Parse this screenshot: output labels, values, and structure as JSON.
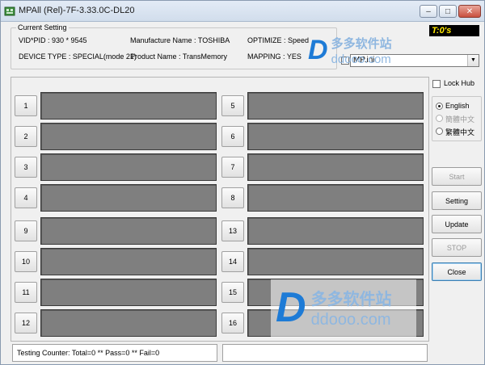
{
  "window": {
    "title": "MPAll (Rel)-7F-3.33.0C-DL20",
    "min_label": "–",
    "max_label": "□",
    "close_label": "✕"
  },
  "current_setting": {
    "title": "Current Setting",
    "vid_pid": "VID*PID :  930 * 9545",
    "manufacture": "Manufacture Name : TOSHIBA",
    "optimize": "OPTIMIZE : Speed",
    "device_type": "DEVICE TYPE : SPECIAL(mode 21)",
    "product": "Product Name : TransMemory",
    "mapping": "MAPPING : YES"
  },
  "timer": "T:0's",
  "ini": {
    "value": "MP.ini",
    "arrow": "▼"
  },
  "ports_left": [
    "1",
    "2",
    "3",
    "4",
    "9",
    "10",
    "11",
    "12"
  ],
  "ports_right": [
    "5",
    "6",
    "7",
    "8",
    "13",
    "14",
    "15",
    "16"
  ],
  "lock_hub": "Lock Hub",
  "languages": {
    "english": "English",
    "simplified": "簡體中文",
    "traditional": "繁體中文"
  },
  "buttons": {
    "start": "Start",
    "setting": "Setting",
    "update": "Update",
    "stop": "STOP",
    "close": "Close"
  },
  "status": {
    "counter": "Testing Counter: Total=0 ** Pass=0 ** Fail=0",
    "right": ""
  },
  "watermark": {
    "logo": "D",
    "cn": "多多软件站",
    "url": "ddooo.com"
  },
  "colors": {
    "port_bar": "#7f7f7f",
    "timer_bg": "#000000",
    "timer_fg": "#ffe800",
    "watermark": "#1e7bd6"
  }
}
